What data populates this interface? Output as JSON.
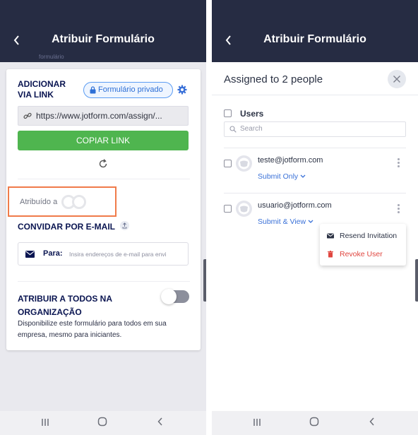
{
  "left": {
    "title": "Atribuir Formulário",
    "back_icon": "chevron-left-icon",
    "faint_header_text": "formulário",
    "add_via_link_title": "ADICIONAR\nVIA LINK",
    "private_badge": "Formulário privado",
    "link_value": "https://www.jotform.com/assign/...",
    "copy_button": "COPIAR LINK",
    "assigned_label": "Atribuído a",
    "invite_title": "CONVIDAR POR E-MAIL",
    "email_to_label": "Para:",
    "email_placeholder": "Insira endereços de e-mail para envi",
    "org_title": "ATRIBUIR A TODOS NA\nORGANIZAÇÃO",
    "org_description": "Disponibilize este formulário para todos em sua empresa, mesmo para iniciantes.",
    "org_toggle_on": false
  },
  "right": {
    "title": "Atribuir Formulário",
    "sheet_title": "Assigned to 2 people",
    "users_label": "Users",
    "search_placeholder": "Search",
    "users": [
      {
        "email": "teste@jotform.com",
        "role": "Submit Only"
      },
      {
        "email": "usuario@jotform.com",
        "role": "Submit & View"
      }
    ],
    "menu": {
      "resend": "Resend Invitation",
      "revoke": "Revoke User"
    }
  },
  "navbar": {
    "recents_icon": "recents-icon",
    "home_icon": "home-icon",
    "back_icon": "back-icon"
  },
  "colors": {
    "header_bg": "#262c43",
    "accent_green": "#4fb54f",
    "highlight_orange": "#f07b4a",
    "link_blue": "#3a71d8",
    "danger_red": "#e0463f"
  }
}
